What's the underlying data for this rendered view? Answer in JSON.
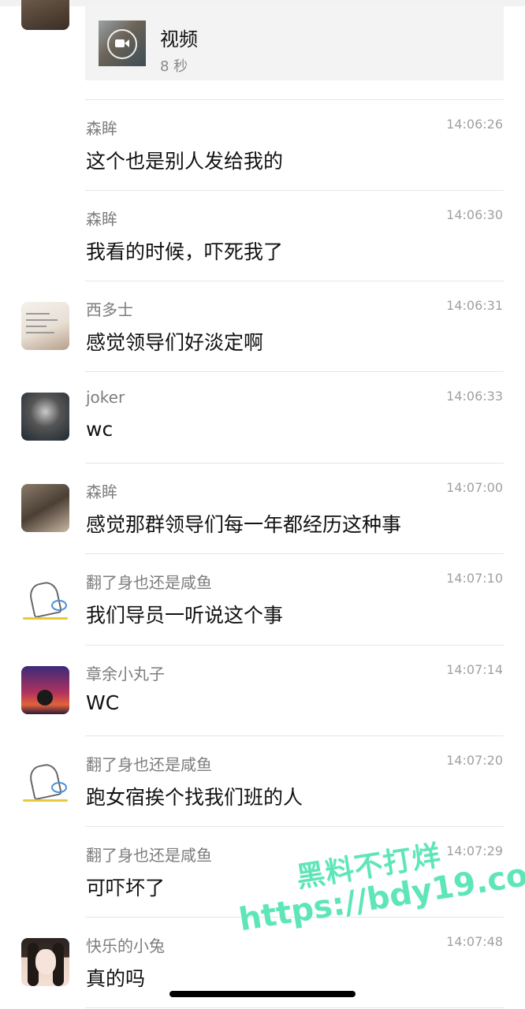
{
  "video": {
    "title": "视频",
    "duration": "8 秒"
  },
  "messages": [
    {
      "sender": "森眸",
      "time": "14:06:26",
      "text": "这个也是别人发给我的",
      "avatar": "none"
    },
    {
      "sender": "森眸",
      "time": "14:06:30",
      "text": "我看的时候，吓死我了",
      "avatar": "none"
    },
    {
      "sender": "西多士",
      "time": "14:06:31",
      "text": "感觉领导们好淡定啊",
      "avatar": "note-photo-avatar"
    },
    {
      "sender": "joker",
      "time": "14:06:33",
      "text": "wc",
      "avatar": "joker-avatar"
    },
    {
      "sender": "森眸",
      "time": "14:07:00",
      "text": "感觉那群领导们每一年都经历这种事",
      "avatar": "senmou-avatar"
    },
    {
      "sender": "翻了身也还是咸鱼",
      "time": "14:07:10",
      "text": "我们导员一听说这个事",
      "avatar": "fish-sketch-avatar"
    },
    {
      "sender": "章余小丸子",
      "time": "14:07:14",
      "text": "WC",
      "avatar": "sunset-avatar"
    },
    {
      "sender": "翻了身也还是咸鱼",
      "time": "14:07:20",
      "text": "跑女宿挨个找我们班的人",
      "avatar": "fish-sketch-avatar"
    },
    {
      "sender": "翻了身也还是咸鱼",
      "time": "14:07:29",
      "text": "可吓坏了",
      "avatar": "none"
    },
    {
      "sender": "快乐的小兔",
      "time": "14:07:48",
      "text": "真的吗",
      "avatar": "girl-avatar"
    }
  ],
  "watermark": {
    "cn": "黑料不打烊",
    "url": "https://bdy19.co"
  },
  "colors": {
    "watermark": "#5ee6b9",
    "divider": "#e6e6e6",
    "meta_text": "#7d7d7d"
  }
}
